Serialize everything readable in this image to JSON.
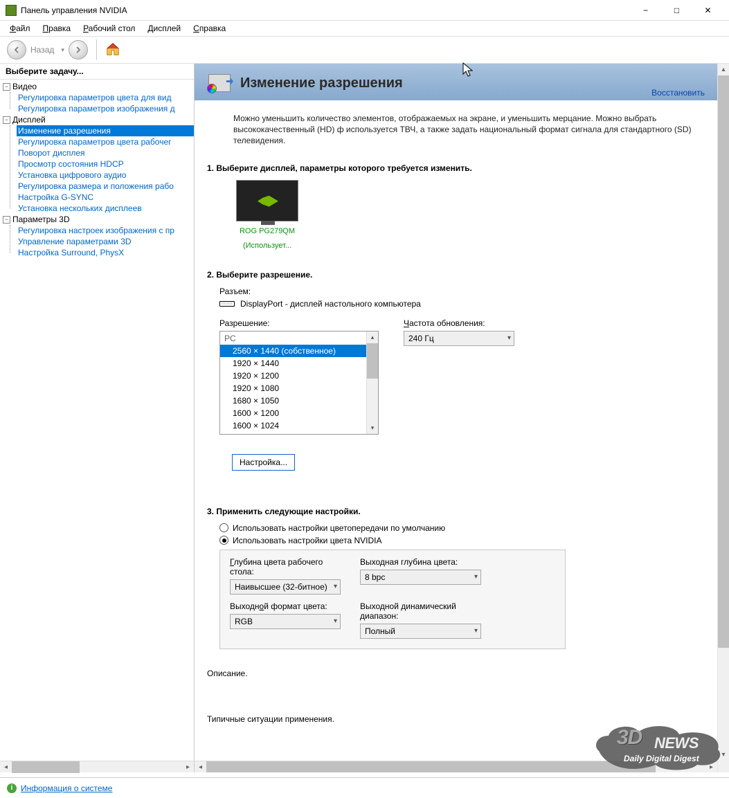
{
  "window": {
    "title": "Панель управления NVIDIA"
  },
  "menu": {
    "file": {
      "u": "Ф",
      "rest": "айл"
    },
    "edit": {
      "u": "П",
      "rest": "равка"
    },
    "desktop": {
      "u": "Р",
      "rest": "абочий стол"
    },
    "display": {
      "u": "Д",
      "rest": "исплей"
    },
    "help": {
      "u": "С",
      "rest": "правка"
    }
  },
  "nav": {
    "back_label": "Назад"
  },
  "sidebar": {
    "header": "Выберите задачу...",
    "cats": {
      "video": "Видео",
      "display": "Дисплей",
      "params3d": "Параметры 3D"
    },
    "video_items": [
      "Регулировка параметров цвета для вид",
      "Регулировка параметров изображения д"
    ],
    "display_items": [
      "Изменение разрешения",
      "Регулировка параметров цвета рабочег",
      "Поворот дисплея",
      "Просмотр состояния HDCP",
      "Установка цифрового аудио",
      "Регулировка размера и положения рабо",
      "Настройка G-SYNC",
      "Установка нескольких дисплеев"
    ],
    "p3d_items": [
      "Регулировка настроек изображения с пр",
      "Управление параметрами 3D",
      "Настройка Surround, PhysX"
    ],
    "selected": "Изменение разрешения"
  },
  "page": {
    "title": "Изменение разрешения",
    "restore": "Восстановить",
    "desc": "Можно уменьшить количество элементов, отображаемых на экране, и уменьшить мерцание. Можно выбрать высококачественный (HD) ф используется ТВЧ, а также задать национальный формат сигнала для стандартного (SD) телевидения.",
    "step1": "1. Выберите дисплей, параметры которого требуется изменить.",
    "step2": "2. Выберите разрешение.",
    "step3": "3. Применить следующие настройки.",
    "display_name": "ROG PG279QM",
    "display_sub": "(Использует...",
    "connector_label": "Разъем:",
    "connector_value": "DisplayPort - дисплей настольного компьютера",
    "resolution_label": "Разрешение:",
    "refresh_label_u": "Ч",
    "refresh_label_rest": "астота обновления:",
    "resolution_group": "PC",
    "resolutions": [
      "2560 × 1440 (собственное)",
      "1920 × 1440",
      "1920 × 1200",
      "1920 × 1080",
      "1680 × 1050",
      "1600 × 1200",
      "1600 × 1024"
    ],
    "resolution_selected": "2560 × 1440 (собственное)",
    "refresh_value": "240 Гц",
    "customize_btn": "Настройка...",
    "radio_default": "Использовать настройки цветопередачи по умолчанию",
    "radio_nvidia": "Использовать настройки цвета NVIDIA",
    "cs": {
      "desktop_depth_label_u": "Г",
      "desktop_depth_label_rest": "лубина цвета рабочего стола:",
      "desktop_depth_value": "Наивысшее (32-битное)",
      "output_depth_label": "Выходная глубина цвета:",
      "output_depth_value": "8 bpc",
      "output_format_label_pre": "Выходн",
      "output_format_label_u": "о",
      "output_format_label_post": "й формат цвета:",
      "output_format_value": "RGB",
      "dynamic_range_label": "Выходной динамический диапазон:",
      "dynamic_range_value": "Полный"
    },
    "desc_heading": "Описание.",
    "typical_heading": "Типичные ситуации применения."
  },
  "statusbar": {
    "link": "Информация о системе"
  },
  "watermark": {
    "brand3d": "3D",
    "brandnews": "NEWS",
    "sub": "Daily Digital Digest"
  }
}
